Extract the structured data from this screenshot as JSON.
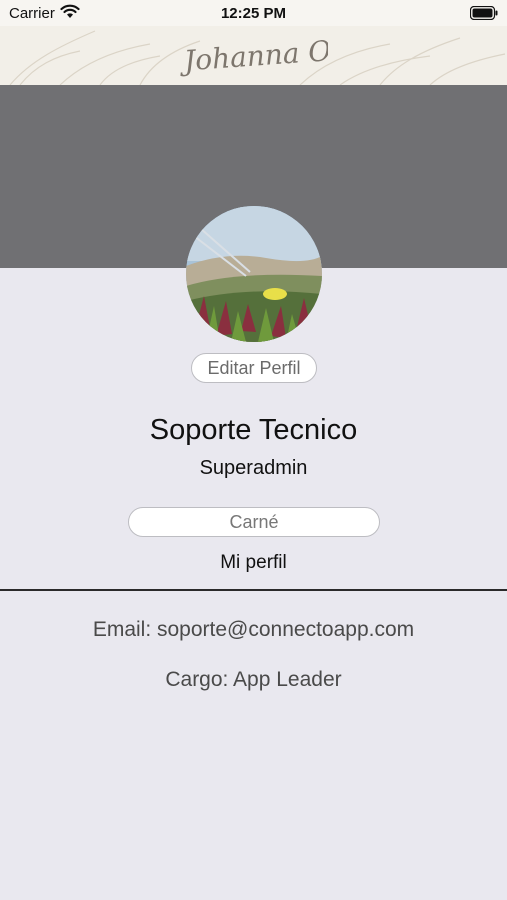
{
  "status_bar": {
    "carrier": "Carrier",
    "time": "12:25 PM"
  },
  "header": {
    "logo_text": "Johanna Ortiz"
  },
  "profile": {
    "edit_button": "Editar Perfil",
    "name": "Soporte Tecnico",
    "role": "Superadmin",
    "carne_placeholder": "Carné",
    "section_title": "Mi perfil",
    "email_line": "Email: soporte@connectoapp.com",
    "cargo_line": "Cargo: App Leader"
  },
  "colors": {
    "cover": "#707073",
    "background": "#e9e8ef",
    "header_bg": "#f2efe8"
  },
  "icons": [
    "wifi-icon",
    "battery-icon",
    "profile-photo"
  ]
}
